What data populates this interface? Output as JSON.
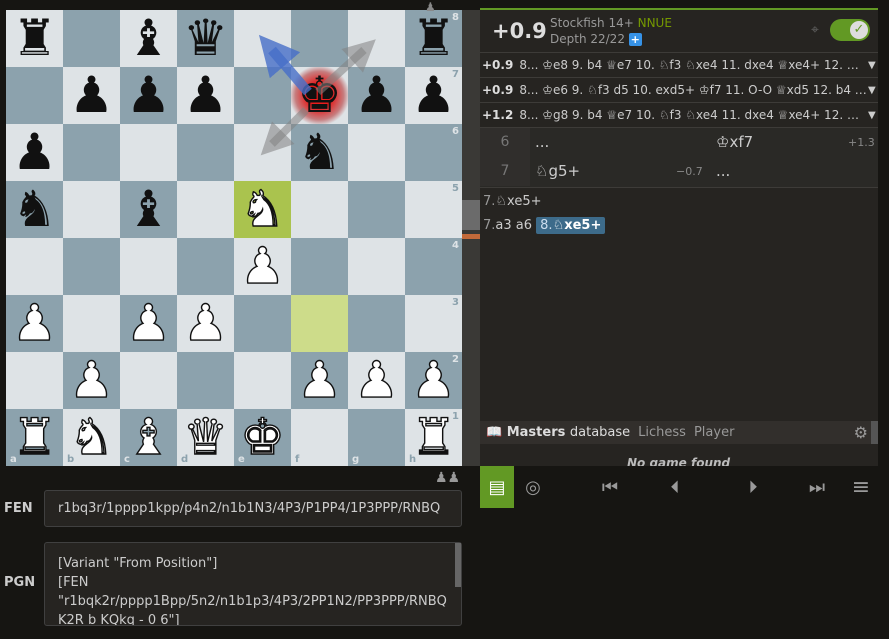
{
  "board": {
    "files": [
      "a",
      "b",
      "c",
      "d",
      "e",
      "f",
      "g",
      "h"
    ],
    "ranks": [
      "8",
      "7",
      "6",
      "5",
      "4",
      "3",
      "2",
      "1"
    ],
    "rows": [
      [
        "br",
        "",
        "bb",
        "bq",
        "",
        "",
        "",
        "br"
      ],
      [
        "",
        "bp",
        "bp",
        "bp",
        "",
        "bk",
        "bp",
        "bp"
      ],
      [
        "bp",
        "",
        "",
        "",
        "",
        "bn",
        "",
        ""
      ],
      [
        "bn",
        "",
        "bb",
        "",
        "wn",
        "",
        "",
        ""
      ],
      [
        "",
        "",
        "",
        "",
        "wp",
        "",
        "",
        ""
      ],
      [
        "wp",
        "",
        "wp",
        "wp",
        "",
        "",
        "",
        ""
      ],
      [
        "",
        "wp",
        "",
        "",
        "",
        "wp",
        "wp",
        "wp"
      ],
      [
        "wr",
        "wn",
        "wb",
        "wq",
        "wk",
        "",
        "",
        "wr"
      ]
    ],
    "highlight_squares": [
      "e5",
      "f3"
    ],
    "check_square": "f7"
  },
  "engine": {
    "score": "+0.9",
    "name": "Stockfish 14+",
    "nnue": "NNUE",
    "depth": "Depth 22/22",
    "depth_plus": "+",
    "target_icon": "target-icon",
    "toggle_on": true,
    "pv_lines": [
      {
        "score": "+0.9",
        "moves": "8... ♔e8 9. b4 ♕e7 10. ♘f3 ♘xe4 11. dxe4 ♕xe4+ 12. ♔f1..."
      },
      {
        "score": "+0.9",
        "moves": "8... ♔e6 9. ♘f3 d5 10. exd5+ ♔f7 11. O-O ♕xd5 12. b4 b..."
      },
      {
        "score": "+1.2",
        "moves": "8... ♔g8 9. b4 ♕e7 10. ♘f3 ♘xe4 11. dxe4 ♕xe4+ 12. ♔f1..."
      }
    ]
  },
  "moves": {
    "rows": [
      {
        "num": "6",
        "white": "...",
        "black": "♔xf7",
        "black_eval": "+1.3"
      },
      {
        "num": "7",
        "white": "♘g5+",
        "white_eval": "−0.7",
        "black": "..."
      }
    ],
    "variation1": "♘xe5+",
    "variation1_num": "7.",
    "variation2_prefix": "7.",
    "variation2_moves": "a3 a6",
    "variation2_active_num": "8.",
    "variation2_active": "♘xe5+"
  },
  "explorer": {
    "tab_active": "Masters",
    "tab_active_suffix": "database",
    "tab_lichess": "Lichess",
    "tab_player": "Player",
    "no_game": "No game found"
  },
  "fen": {
    "label": "FEN",
    "value": "r1bq3r/1pppp1kpp/p4n2/n1b1N3/4P3/P1PP4/1P3PPP/RNBQ"
  },
  "pgn": {
    "label": "PGN",
    "value": "[Variant \"From Position\"]\n[FEN\n\"r1bqk2r/pppp1Bpp/5n2/n1b1p3/4P3/2PP1N2/PP3PPP/RNBQK2R b KQkq - 0 6\"]"
  }
}
